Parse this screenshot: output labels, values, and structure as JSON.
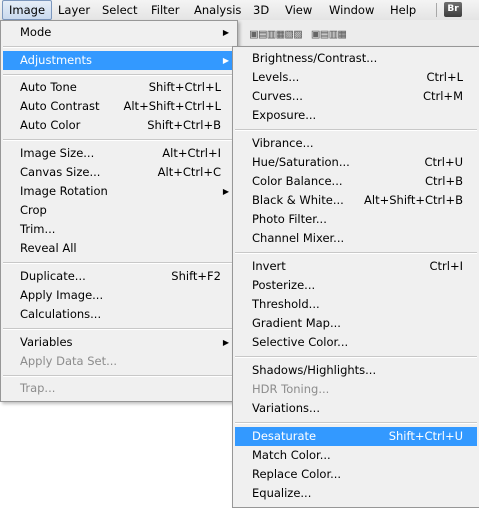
{
  "menubar": {
    "items": [
      "Image",
      "Layer",
      "Select",
      "Filter",
      "Analysis",
      "3D",
      "View",
      "Window",
      "Help"
    ],
    "badge": "Br"
  },
  "image_menu": {
    "items": [
      {
        "label": "Mode",
        "shortcut": "",
        "submenu": true,
        "disabled": false
      },
      {
        "label": "Adjustments",
        "shortcut": "",
        "submenu": true,
        "disabled": false,
        "highlight": true
      },
      {
        "label": "Auto Tone",
        "shortcut": "Shift+Ctrl+L",
        "submenu": false,
        "disabled": false
      },
      {
        "label": "Auto Contrast",
        "shortcut": "Alt+Shift+Ctrl+L",
        "submenu": false,
        "disabled": false
      },
      {
        "label": "Auto Color",
        "shortcut": "Shift+Ctrl+B",
        "submenu": false,
        "disabled": false
      },
      {
        "label": "Image Size...",
        "shortcut": "Alt+Ctrl+I",
        "submenu": false,
        "disabled": false
      },
      {
        "label": "Canvas Size...",
        "shortcut": "Alt+Ctrl+C",
        "submenu": false,
        "disabled": false
      },
      {
        "label": "Image Rotation",
        "shortcut": "",
        "submenu": true,
        "disabled": false
      },
      {
        "label": "Crop",
        "shortcut": "",
        "submenu": false,
        "disabled": false
      },
      {
        "label": "Trim...",
        "shortcut": "",
        "submenu": false,
        "disabled": false
      },
      {
        "label": "Reveal All",
        "shortcut": "",
        "submenu": false,
        "disabled": false
      },
      {
        "label": "Duplicate...",
        "shortcut": "Shift+F2",
        "submenu": false,
        "disabled": false
      },
      {
        "label": "Apply Image...",
        "shortcut": "",
        "submenu": false,
        "disabled": false
      },
      {
        "label": "Calculations...",
        "shortcut": "",
        "submenu": false,
        "disabled": false
      },
      {
        "label": "Variables",
        "shortcut": "",
        "submenu": true,
        "disabled": false
      },
      {
        "label": "Apply Data Set...",
        "shortcut": "",
        "submenu": false,
        "disabled": true
      },
      {
        "label": "Trap...",
        "shortcut": "",
        "submenu": false,
        "disabled": true
      }
    ]
  },
  "adjustments_menu": {
    "items": [
      {
        "label": "Brightness/Contrast...",
        "shortcut": "",
        "disabled": false
      },
      {
        "label": "Levels...",
        "shortcut": "Ctrl+L",
        "disabled": false
      },
      {
        "label": "Curves...",
        "shortcut": "Ctrl+M",
        "disabled": false
      },
      {
        "label": "Exposure...",
        "shortcut": "",
        "disabled": false
      },
      {
        "label": "Vibrance...",
        "shortcut": "",
        "disabled": false
      },
      {
        "label": "Hue/Saturation...",
        "shortcut": "Ctrl+U",
        "disabled": false
      },
      {
        "label": "Color Balance...",
        "shortcut": "Ctrl+B",
        "disabled": false
      },
      {
        "label": "Black & White...",
        "shortcut": "Alt+Shift+Ctrl+B",
        "disabled": false
      },
      {
        "label": "Photo Filter...",
        "shortcut": "",
        "disabled": false
      },
      {
        "label": "Channel Mixer...",
        "shortcut": "",
        "disabled": false
      },
      {
        "label": "Invert",
        "shortcut": "Ctrl+I",
        "disabled": false
      },
      {
        "label": "Posterize...",
        "shortcut": "",
        "disabled": false
      },
      {
        "label": "Threshold...",
        "shortcut": "",
        "disabled": false
      },
      {
        "label": "Gradient Map...",
        "shortcut": "",
        "disabled": false
      },
      {
        "label": "Selective Color...",
        "shortcut": "",
        "disabled": false
      },
      {
        "label": "Shadows/Highlights...",
        "shortcut": "",
        "disabled": false
      },
      {
        "label": "HDR Toning...",
        "shortcut": "",
        "disabled": true
      },
      {
        "label": "Variations...",
        "shortcut": "",
        "disabled": false
      },
      {
        "label": "Desaturate",
        "shortcut": "Shift+Ctrl+U",
        "disabled": false,
        "highlight": true
      },
      {
        "label": "Match Color...",
        "shortcut": "",
        "disabled": false
      },
      {
        "label": "Replace Color...",
        "shortcut": "",
        "disabled": false
      },
      {
        "label": "Equalize...",
        "shortcut": "",
        "disabled": false
      }
    ]
  },
  "colors": {
    "highlight": "#3399ff",
    "menu_bg": "#f0f0f0",
    "disabled": "#8c8c8c"
  }
}
